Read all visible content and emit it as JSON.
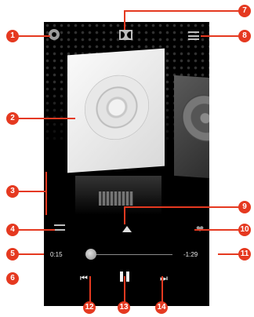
{
  "player": {
    "elapsed": "0:15",
    "remaining": "-1:29",
    "progress_fraction": 0.15
  },
  "icons": {
    "settings": "settings-icon",
    "dolby": "dolby-icon",
    "playlist": "playlist-icon",
    "shuffle": "shuffle-icon",
    "expand": "expand-up-icon",
    "favorite": "heart-icon",
    "previous": "previous-icon",
    "pause": "pause-icon",
    "next": "next-icon"
  },
  "callouts": [
    "1",
    "2",
    "3",
    "4",
    "5",
    "6",
    "7",
    "8",
    "9",
    "10",
    "11",
    "12",
    "13",
    "14"
  ],
  "colors": {
    "callout": "#e53920",
    "screen": "#000000"
  }
}
